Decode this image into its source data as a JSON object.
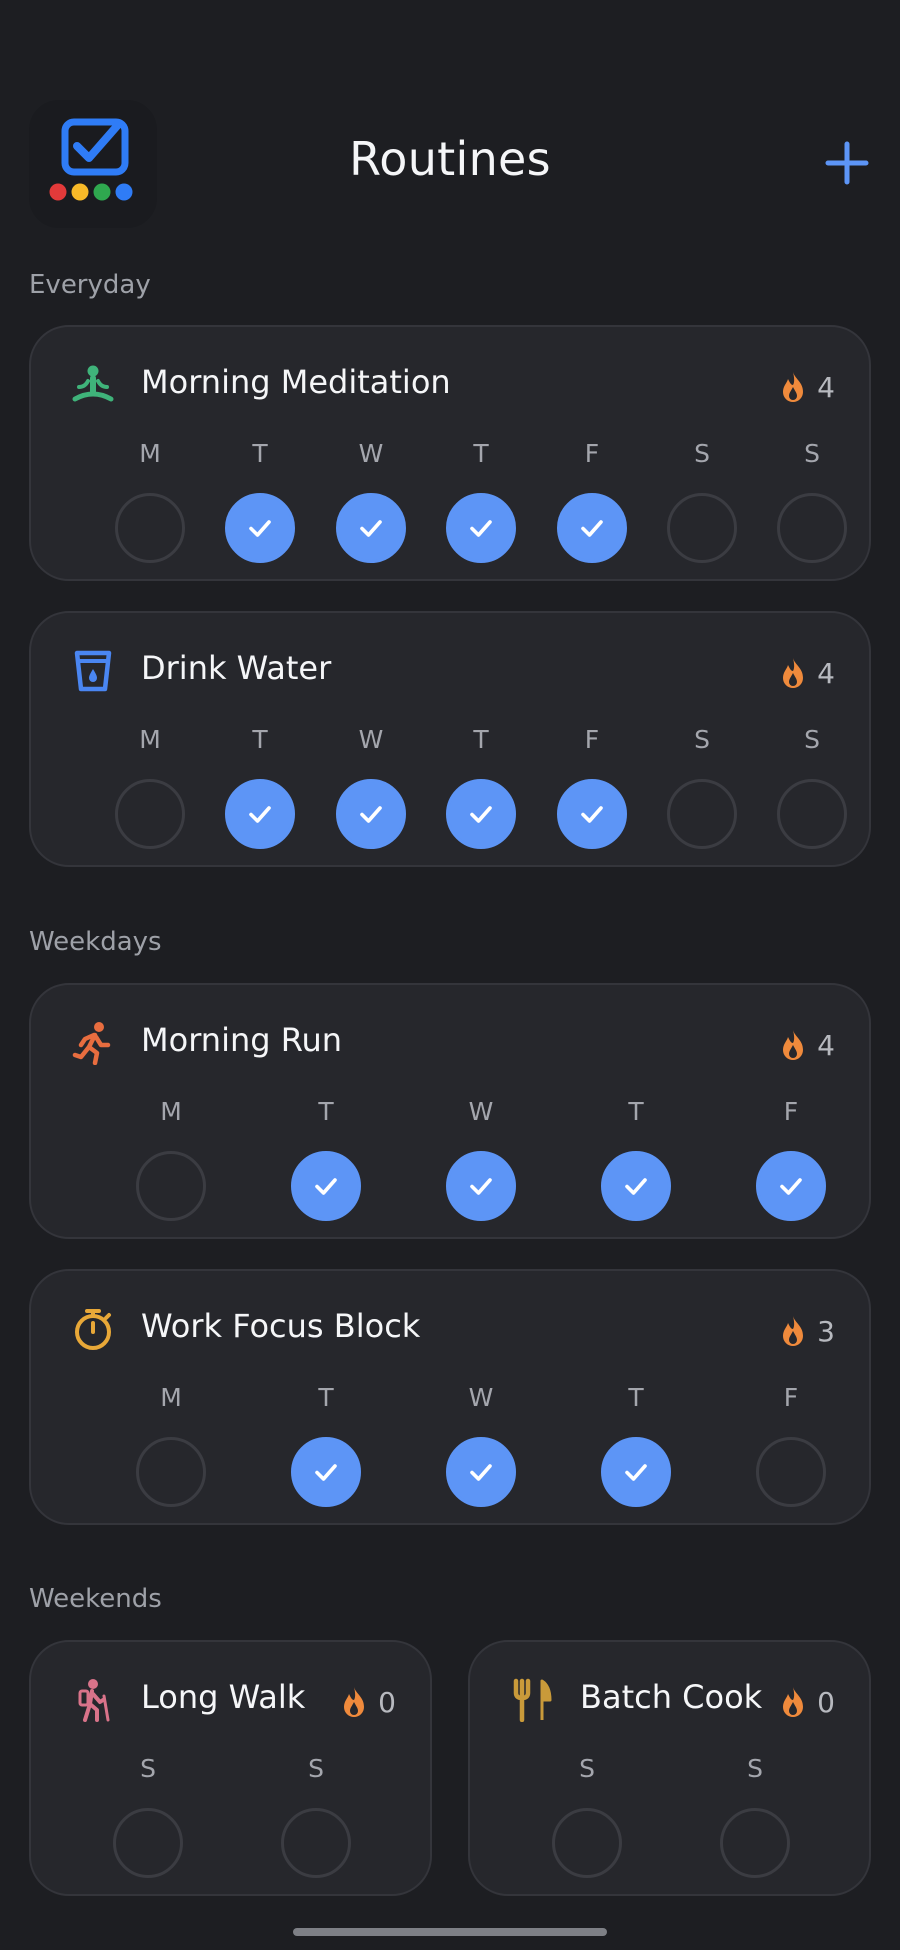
{
  "header": {
    "title": "Routines",
    "app_icon": "checklist-app-icon",
    "add_icon": "plus-icon"
  },
  "sections": [
    {
      "label": "Everyday"
    },
    {
      "label": "Weekdays"
    },
    {
      "label": "Weekends"
    }
  ],
  "routines": [
    {
      "name": "Morning Meditation",
      "icon": "meditation-icon",
      "icon_color": "#3fb37a",
      "streak": "4",
      "days": [
        {
          "d": "M",
          "done": false
        },
        {
          "d": "T",
          "done": true
        },
        {
          "d": "W",
          "done": true
        },
        {
          "d": "T",
          "done": true
        },
        {
          "d": "F",
          "done": true
        },
        {
          "d": "S",
          "done": false
        },
        {
          "d": "S",
          "done": false
        }
      ]
    },
    {
      "name": "Drink Water",
      "icon": "water-glass-icon",
      "icon_color": "#4a86f2",
      "streak": "4",
      "days": [
        {
          "d": "M",
          "done": false
        },
        {
          "d": "T",
          "done": true
        },
        {
          "d": "W",
          "done": true
        },
        {
          "d": "T",
          "done": true
        },
        {
          "d": "F",
          "done": true
        },
        {
          "d": "S",
          "done": false
        },
        {
          "d": "S",
          "done": false
        }
      ]
    },
    {
      "name": "Morning Run",
      "icon": "runner-icon",
      "icon_color": "#e86d3f",
      "streak": "4",
      "days": [
        {
          "d": "M",
          "done": false
        },
        {
          "d": "T",
          "done": true
        },
        {
          "d": "W",
          "done": true
        },
        {
          "d": "T",
          "done": true
        },
        {
          "d": "F",
          "done": true
        }
      ]
    },
    {
      "name": "Work Focus Block",
      "icon": "stopwatch-icon",
      "icon_color": "#e8a838",
      "streak": "3",
      "days": [
        {
          "d": "M",
          "done": false
        },
        {
          "d": "T",
          "done": true
        },
        {
          "d": "W",
          "done": true
        },
        {
          "d": "T",
          "done": true
        },
        {
          "d": "F",
          "done": false
        }
      ]
    },
    {
      "name": "Long Walk",
      "icon": "hiker-icon",
      "icon_color": "#d9738a",
      "streak": "0",
      "days": [
        {
          "d": "S",
          "done": false
        },
        {
          "d": "S",
          "done": false
        }
      ]
    },
    {
      "name": "Batch Cook",
      "icon": "fork-knife-icon",
      "icon_color": "#c99a3a",
      "streak": "0",
      "days": [
        {
          "d": "S",
          "done": false
        },
        {
          "d": "S",
          "done": false
        }
      ]
    }
  ],
  "colors": {
    "accent": "#5d95f6",
    "streak_flame": "#ef8a3c",
    "background": "#1d1e22",
    "card": "#26272c"
  }
}
